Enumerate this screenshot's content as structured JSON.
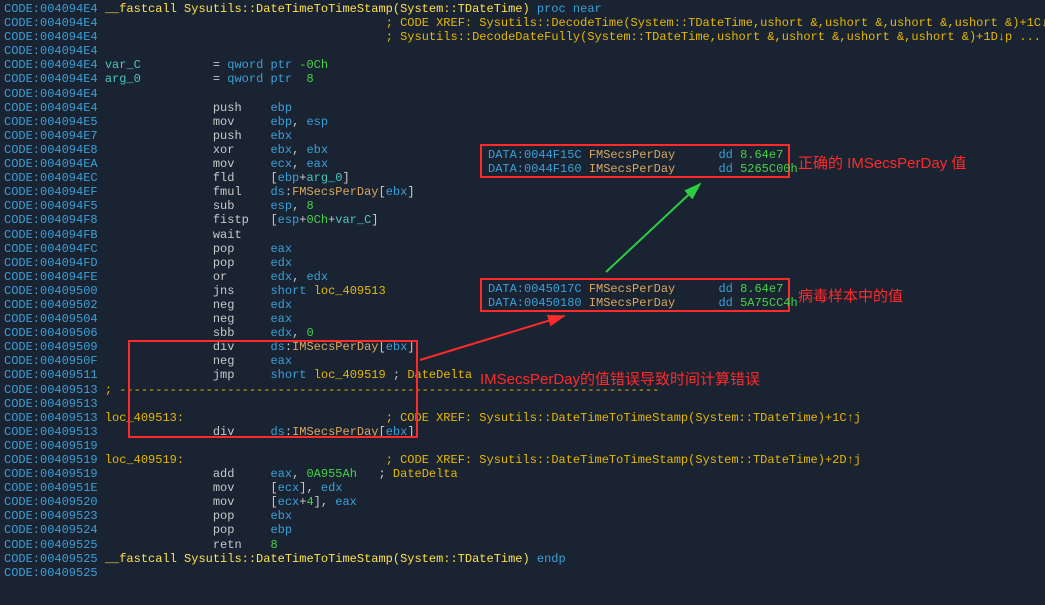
{
  "lines": [
    {
      "addr": "CODE:004094E4",
      "body": [
        {
          "c": "fn",
          "t": "__fastcall Sysutils::DateTimeToTimeStamp(System::TDateTime)"
        },
        {
          "c": "kw",
          "t": " proc near"
        }
      ]
    },
    {
      "addr": "CODE:004094E4",
      "body": [
        {
          "c": "op",
          "t": "                                       "
        },
        {
          "c": "cmt",
          "t": "; CODE XREF: Sysutils::DecodeTime(System::TDateTime,ushort &,ushort &,ushort &,ushort &)+1C↓p"
        }
      ]
    },
    {
      "addr": "CODE:004094E4",
      "body": [
        {
          "c": "op",
          "t": "                                       "
        },
        {
          "c": "cmt",
          "t": "; Sysutils::DecodeDateFully(System::TDateTime,ushort &,ushort &,ushort &,ushort &)+1D↓p ..."
        }
      ]
    },
    {
      "addr": "CODE:004094E4",
      "body": []
    },
    {
      "addr": "CODE:004094E4",
      "body": [
        {
          "c": "cyan",
          "t": "var_C"
        },
        {
          "c": "op",
          "t": "          = "
        },
        {
          "c": "kw",
          "t": "qword ptr"
        },
        {
          "c": "num",
          "t": " -0Ch"
        }
      ]
    },
    {
      "addr": "CODE:004094E4",
      "body": [
        {
          "c": "cyan",
          "t": "arg_0"
        },
        {
          "c": "op",
          "t": "          = "
        },
        {
          "c": "kw",
          "t": "qword ptr  "
        },
        {
          "c": "num",
          "t": "8"
        }
      ]
    },
    {
      "addr": "CODE:004094E4",
      "body": []
    },
    {
      "addr": "CODE:004094E4",
      "body": [
        {
          "c": "op",
          "t": "               push    "
        },
        {
          "c": "kw",
          "t": "ebp"
        }
      ]
    },
    {
      "addr": "CODE:004094E5",
      "body": [
        {
          "c": "op",
          "t": "               mov     "
        },
        {
          "c": "kw",
          "t": "ebp"
        },
        {
          "c": "op",
          "t": ", "
        },
        {
          "c": "kw",
          "t": "esp"
        }
      ]
    },
    {
      "addr": "CODE:004094E7",
      "body": [
        {
          "c": "op",
          "t": "               push    "
        },
        {
          "c": "kw",
          "t": "ebx"
        }
      ]
    },
    {
      "addr": "CODE:004094E8",
      "body": [
        {
          "c": "op",
          "t": "               xor     "
        },
        {
          "c": "kw",
          "t": "ebx"
        },
        {
          "c": "op",
          "t": ", "
        },
        {
          "c": "kw",
          "t": "ebx"
        }
      ]
    },
    {
      "addr": "CODE:004094EA",
      "body": [
        {
          "c": "op",
          "t": "               mov     "
        },
        {
          "c": "kw",
          "t": "ecx"
        },
        {
          "c": "op",
          "t": ", "
        },
        {
          "c": "kw",
          "t": "eax"
        }
      ]
    },
    {
      "addr": "CODE:004094EC",
      "body": [
        {
          "c": "op",
          "t": "               fld     ["
        },
        {
          "c": "kw",
          "t": "ebp"
        },
        {
          "c": "op",
          "t": "+"
        },
        {
          "c": "cyan",
          "t": "arg_0"
        },
        {
          "c": "op",
          "t": "]"
        }
      ]
    },
    {
      "addr": "CODE:004094EF",
      "body": [
        {
          "c": "op",
          "t": "               fmul    "
        },
        {
          "c": "kw",
          "t": "ds"
        },
        {
          "c": "op",
          "t": ":"
        },
        {
          "c": "orange",
          "t": "FMSecsPerDay"
        },
        {
          "c": "op",
          "t": "["
        },
        {
          "c": "kw",
          "t": "ebx"
        },
        {
          "c": "op",
          "t": "]"
        }
      ]
    },
    {
      "addr": "CODE:004094F5",
      "body": [
        {
          "c": "op",
          "t": "               sub     "
        },
        {
          "c": "kw",
          "t": "esp"
        },
        {
          "c": "op",
          "t": ", "
        },
        {
          "c": "num",
          "t": "8"
        }
      ]
    },
    {
      "addr": "CODE:004094F8",
      "body": [
        {
          "c": "op",
          "t": "               fistp   ["
        },
        {
          "c": "kw",
          "t": "esp"
        },
        {
          "c": "op",
          "t": "+"
        },
        {
          "c": "num",
          "t": "0Ch"
        },
        {
          "c": "op",
          "t": "+"
        },
        {
          "c": "cyan",
          "t": "var_C"
        },
        {
          "c": "op",
          "t": "]"
        }
      ]
    },
    {
      "addr": "CODE:004094FB",
      "body": [
        {
          "c": "op",
          "t": "               wait"
        }
      ]
    },
    {
      "addr": "CODE:004094FC",
      "body": [
        {
          "c": "op",
          "t": "               pop     "
        },
        {
          "c": "kw",
          "t": "eax"
        }
      ]
    },
    {
      "addr": "CODE:004094FD",
      "body": [
        {
          "c": "op",
          "t": "               pop     "
        },
        {
          "c": "kw",
          "t": "edx"
        }
      ]
    },
    {
      "addr": "CODE:004094FE",
      "body": [
        {
          "c": "op",
          "t": "               or      "
        },
        {
          "c": "kw",
          "t": "edx"
        },
        {
          "c": "op",
          "t": ", "
        },
        {
          "c": "kw",
          "t": "edx"
        }
      ]
    },
    {
      "addr": "CODE:00409500",
      "body": [
        {
          "c": "op",
          "t": "               jns     "
        },
        {
          "c": "kw",
          "t": "short "
        },
        {
          "c": "sym",
          "t": "loc_409513"
        }
      ]
    },
    {
      "addr": "CODE:00409502",
      "body": [
        {
          "c": "op",
          "t": "               neg     "
        },
        {
          "c": "kw",
          "t": "edx"
        }
      ]
    },
    {
      "addr": "CODE:00409504",
      "body": [
        {
          "c": "op",
          "t": "               neg     "
        },
        {
          "c": "kw",
          "t": "eax"
        }
      ]
    },
    {
      "addr": "CODE:00409506",
      "body": [
        {
          "c": "op",
          "t": "               sbb     "
        },
        {
          "c": "kw",
          "t": "edx"
        },
        {
          "c": "op",
          "t": ", "
        },
        {
          "c": "num",
          "t": "0"
        }
      ]
    },
    {
      "addr": "CODE:00409509",
      "body": [
        {
          "c": "op",
          "t": "               div     "
        },
        {
          "c": "kw",
          "t": "ds"
        },
        {
          "c": "op",
          "t": ":"
        },
        {
          "c": "orange",
          "t": "IMSecsPerDay"
        },
        {
          "c": "op",
          "t": "["
        },
        {
          "c": "kw",
          "t": "ebx"
        },
        {
          "c": "op",
          "t": "]"
        }
      ]
    },
    {
      "addr": "CODE:0040950F",
      "body": [
        {
          "c": "op",
          "t": "               neg     "
        },
        {
          "c": "kw",
          "t": "eax"
        }
      ]
    },
    {
      "addr": "CODE:00409511",
      "body": [
        {
          "c": "op",
          "t": "               jmp     "
        },
        {
          "c": "kw",
          "t": "short "
        },
        {
          "c": "sym",
          "t": "loc_409519"
        },
        {
          "c": "op",
          "t": " ; "
        },
        {
          "c": "cmt",
          "t": "DateDelta"
        }
      ]
    },
    {
      "addr": "CODE:00409513",
      "body": [
        {
          "c": "cmt",
          "t": "; ---------------------------------------------------------------------------"
        }
      ]
    },
    {
      "addr": "CODE:00409513",
      "body": []
    },
    {
      "addr": "CODE:00409513",
      "body": [
        {
          "c": "sym",
          "t": "loc_409513:"
        },
        {
          "c": "op",
          "t": "                            "
        },
        {
          "c": "cmt",
          "t": "; CODE XREF: Sysutils::DateTimeToTimeStamp(System::TDateTime)+1C↑j"
        }
      ]
    },
    {
      "addr": "CODE:00409513",
      "body": [
        {
          "c": "op",
          "t": "               div     "
        },
        {
          "c": "kw",
          "t": "ds"
        },
        {
          "c": "op",
          "t": ":"
        },
        {
          "c": "orange",
          "t": "IMSecsPerDay"
        },
        {
          "c": "op",
          "t": "["
        },
        {
          "c": "kw",
          "t": "ebx"
        },
        {
          "c": "op",
          "t": "]"
        }
      ]
    },
    {
      "addr": "CODE:00409519",
      "body": []
    },
    {
      "addr": "CODE:00409519",
      "body": [
        {
          "c": "sym",
          "t": "loc_409519:"
        },
        {
          "c": "op",
          "t": "                            "
        },
        {
          "c": "cmt",
          "t": "; CODE XREF: Sysutils::DateTimeToTimeStamp(System::TDateTime)+2D↑j"
        }
      ]
    },
    {
      "addr": "CODE:00409519",
      "body": [
        {
          "c": "op",
          "t": "               add     "
        },
        {
          "c": "kw",
          "t": "eax"
        },
        {
          "c": "op",
          "t": ", "
        },
        {
          "c": "num",
          "t": "0A955Ah"
        },
        {
          "c": "op",
          "t": "   ; "
        },
        {
          "c": "cmt",
          "t": "DateDelta"
        }
      ]
    },
    {
      "addr": "CODE:0040951E",
      "body": [
        {
          "c": "op",
          "t": "               mov     ["
        },
        {
          "c": "kw",
          "t": "ecx"
        },
        {
          "c": "op",
          "t": "], "
        },
        {
          "c": "kw",
          "t": "edx"
        }
      ]
    },
    {
      "addr": "CODE:00409520",
      "body": [
        {
          "c": "op",
          "t": "               mov     ["
        },
        {
          "c": "kw",
          "t": "ecx"
        },
        {
          "c": "op",
          "t": "+"
        },
        {
          "c": "num",
          "t": "4"
        },
        {
          "c": "op",
          "t": "], "
        },
        {
          "c": "kw",
          "t": "eax"
        }
      ]
    },
    {
      "addr": "CODE:00409523",
      "body": [
        {
          "c": "op",
          "t": "               pop     "
        },
        {
          "c": "kw",
          "t": "ebx"
        }
      ]
    },
    {
      "addr": "CODE:00409524",
      "body": [
        {
          "c": "op",
          "t": "               pop     "
        },
        {
          "c": "kw",
          "t": "ebp"
        }
      ]
    },
    {
      "addr": "CODE:00409525",
      "body": [
        {
          "c": "op",
          "t": "               retn    "
        },
        {
          "c": "num",
          "t": "8"
        }
      ]
    },
    {
      "addr": "CODE:00409525",
      "body": [
        {
          "c": "fn",
          "t": "__fastcall Sysutils::DateTimeToTimeStamp(System::TDateTime)"
        },
        {
          "c": "kw",
          "t": " endp"
        }
      ]
    },
    {
      "addr": "CODE:00409525",
      "body": []
    },
    {
      "addr": "",
      "body": []
    }
  ],
  "box1": {
    "lines": [
      {
        "addr": "DATA:0044F15C",
        "name": "FMSecsPerDay",
        "type": "dd",
        "val": "8.64e7"
      },
      {
        "addr": "DATA:0044F160",
        "name": "IMSecsPerDay",
        "type": "dd",
        "val": "5265C00h"
      }
    ],
    "label": "正确的 IMSecsPerDay 值"
  },
  "box2": {
    "lines": [
      {
        "addr": "DATA:0045017C",
        "name": "FMSecsPerDay",
        "type": "dd",
        "val": "8.64e7"
      },
      {
        "addr": "DATA:00450180",
        "name": "IMSecsPerDay",
        "type": "dd",
        "val": "5A75CC4h"
      }
    ],
    "label": "病毒样本中的值"
  },
  "middle_label": "IMSecsPerDay的值错误导致时间计算错误"
}
